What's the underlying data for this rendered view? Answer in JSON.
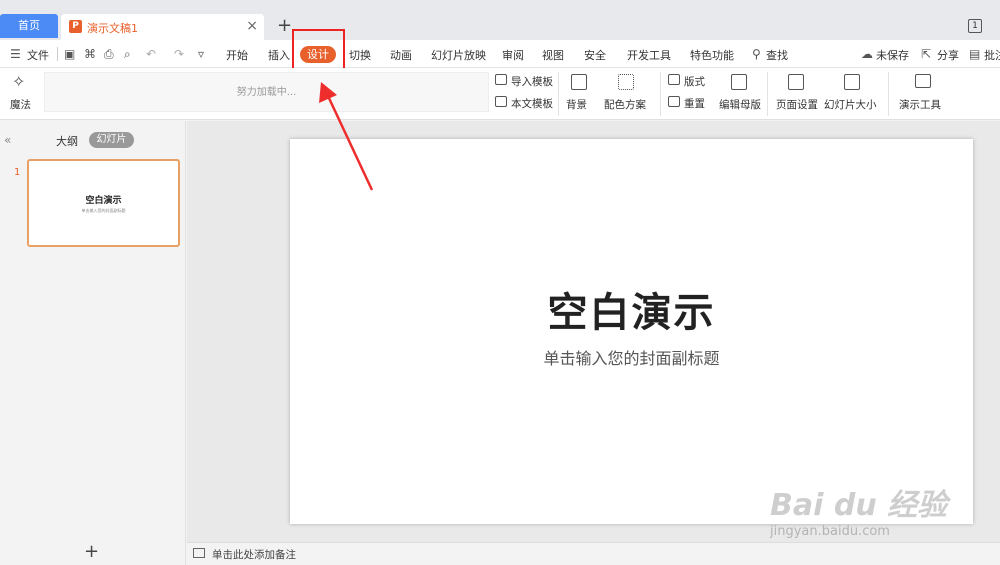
{
  "tabs": {
    "home": "首页",
    "doc": "演示文稿1",
    "close": "×",
    "add": "+",
    "badge": "1"
  },
  "menu": {
    "file": "文件",
    "items": [
      "开始",
      "插入",
      "设计",
      "切换",
      "动画",
      "幻灯片放映",
      "审阅",
      "视图",
      "安全",
      "开发工具",
      "特色功能"
    ],
    "active": "设计",
    "search": "查找",
    "unsaved": "未保存",
    "share": "分享",
    "comment": "批注"
  },
  "ribbon": {
    "magic": "魔法",
    "loading": "努力加载中...",
    "import_template": "导入模板",
    "this_template": "本文模板",
    "background": "背景",
    "color_scheme": "配色方案",
    "layout": "版式",
    "reset": "重置",
    "edit_master": "编辑母版",
    "page_setup": "页面设置",
    "slide_size": "幻灯片大小",
    "presenter_tools": "演示工具"
  },
  "left_panel": {
    "outline": "大纲",
    "slides": "幻灯片",
    "slide_number": "1",
    "thumb_title": "空白演示",
    "thumb_subtitle": "单击输入您的封面副标题",
    "add": "+"
  },
  "slide": {
    "title": "空白演示",
    "subtitle": "单击输入您的封面副标题"
  },
  "notes": {
    "placeholder": "单击此处添加备注"
  },
  "watermark": {
    "logo": "Bai du 经验",
    "url": "jingyan.baidu.com"
  },
  "colors": {
    "accent": "#e8612c",
    "home_tab": "#4c8af5",
    "highlight": "#e22222"
  }
}
